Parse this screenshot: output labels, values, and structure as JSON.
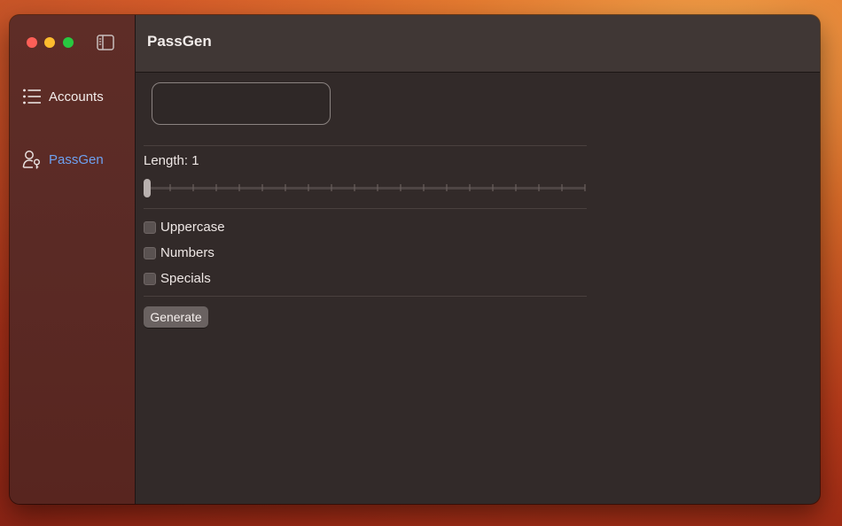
{
  "window": {
    "title": "PassGen"
  },
  "sidebar": {
    "items": [
      {
        "label": "Accounts",
        "icon": "list-icon",
        "active": false
      },
      {
        "label": "PassGen",
        "icon": "person-key-icon",
        "active": true
      }
    ]
  },
  "generator": {
    "password_value": "",
    "length_label": "Length: 1",
    "length_value": 1,
    "options": [
      {
        "label": "Uppercase",
        "checked": false
      },
      {
        "label": "Numbers",
        "checked": false
      },
      {
        "label": "Specials",
        "checked": false
      }
    ],
    "generate_label": "Generate"
  },
  "colors": {
    "accent": "#6ea1f0",
    "close": "#fe5f57",
    "minimize": "#febc2e",
    "maximize": "#28c840"
  }
}
